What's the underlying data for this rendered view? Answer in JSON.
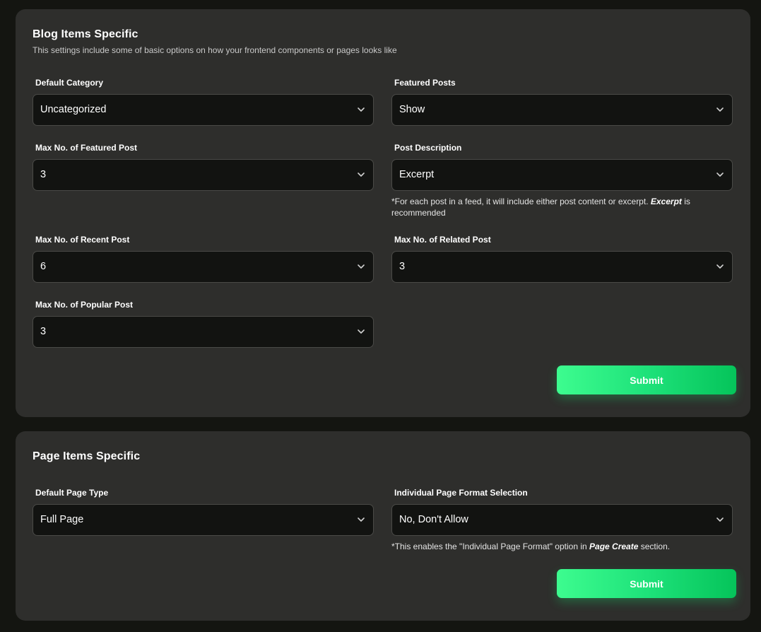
{
  "blog": {
    "title": "Blog Items Specific",
    "subtitle": "This settings include some of basic options on how your frontend components or pages looks like",
    "default_category": {
      "label": "Default Category",
      "value": "Uncategorized"
    },
    "featured_posts": {
      "label": "Featured Posts",
      "value": "Show"
    },
    "max_featured": {
      "label": "Max No. of Featured Post",
      "value": "3"
    },
    "post_description": {
      "label": "Post Description",
      "value": "Excerpt",
      "hint_before": "*For each post in a feed, it will include either post content or excerpt. ",
      "hint_bold": "Excerpt",
      "hint_after": " is recommended"
    },
    "max_recent": {
      "label": "Max No. of Recent Post",
      "value": "6"
    },
    "max_related": {
      "label": "Max No. of Related Post",
      "value": "3"
    },
    "max_popular": {
      "label": "Max No. of Popular Post",
      "value": "3"
    },
    "submit_label": "Submit"
  },
  "page": {
    "title": "Page Items Specific",
    "default_page_type": {
      "label": "Default Page Type",
      "value": "Full Page"
    },
    "individual_format": {
      "label": "Individual Page Format Selection",
      "value": "No, Don't Allow",
      "hint_before": "*This enables the \"Individual Page Format\" option in ",
      "hint_bold": "Page Create",
      "hint_after": " section."
    },
    "submit_label": "Submit"
  },
  "icons": {
    "dropdown": "chevron-down-icon"
  },
  "colors": {
    "accent_start": "#3dfc8f",
    "accent_end": "#05c45a",
    "card": "#2e2e2c",
    "field": "#121311"
  }
}
